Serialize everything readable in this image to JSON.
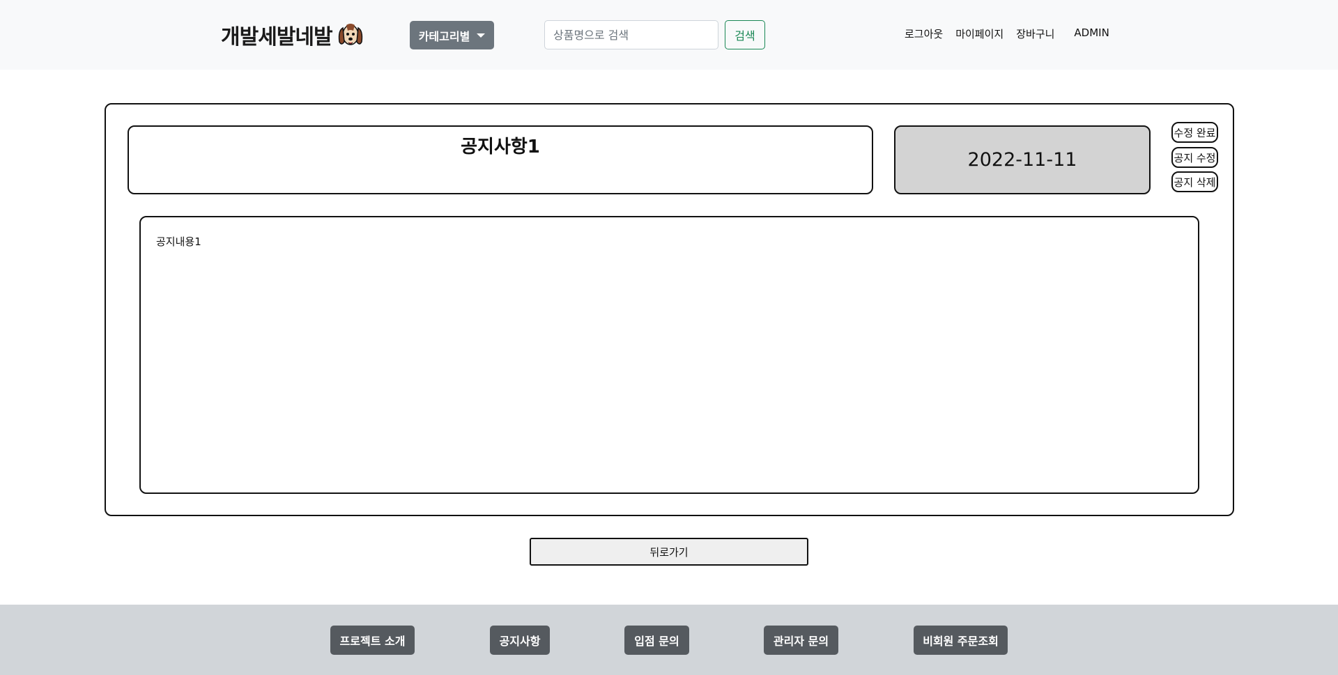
{
  "header": {
    "logo_text": "개발세발네발",
    "category_label": "카테고리별",
    "search": {
      "placeholder": "상품명으로 검색",
      "value": ""
    },
    "search_button": "검색",
    "nav": {
      "logout": "로그아웃",
      "mypage": "마이페이지",
      "cart": "장바구니",
      "admin": "ADMIN"
    }
  },
  "notice": {
    "title": "공지사항1",
    "date": "2022-11-11",
    "content": "공지내용1",
    "actions": {
      "complete": "수정 완료",
      "edit": "공지 수정",
      "delete": "공지 삭제"
    }
  },
  "back_button": "뒤로가기",
  "footer": {
    "items": [
      "프로젝트 소개",
      "공지사항",
      "입점 문의",
      "관리자 문의",
      "비회원 주문조회"
    ]
  }
}
